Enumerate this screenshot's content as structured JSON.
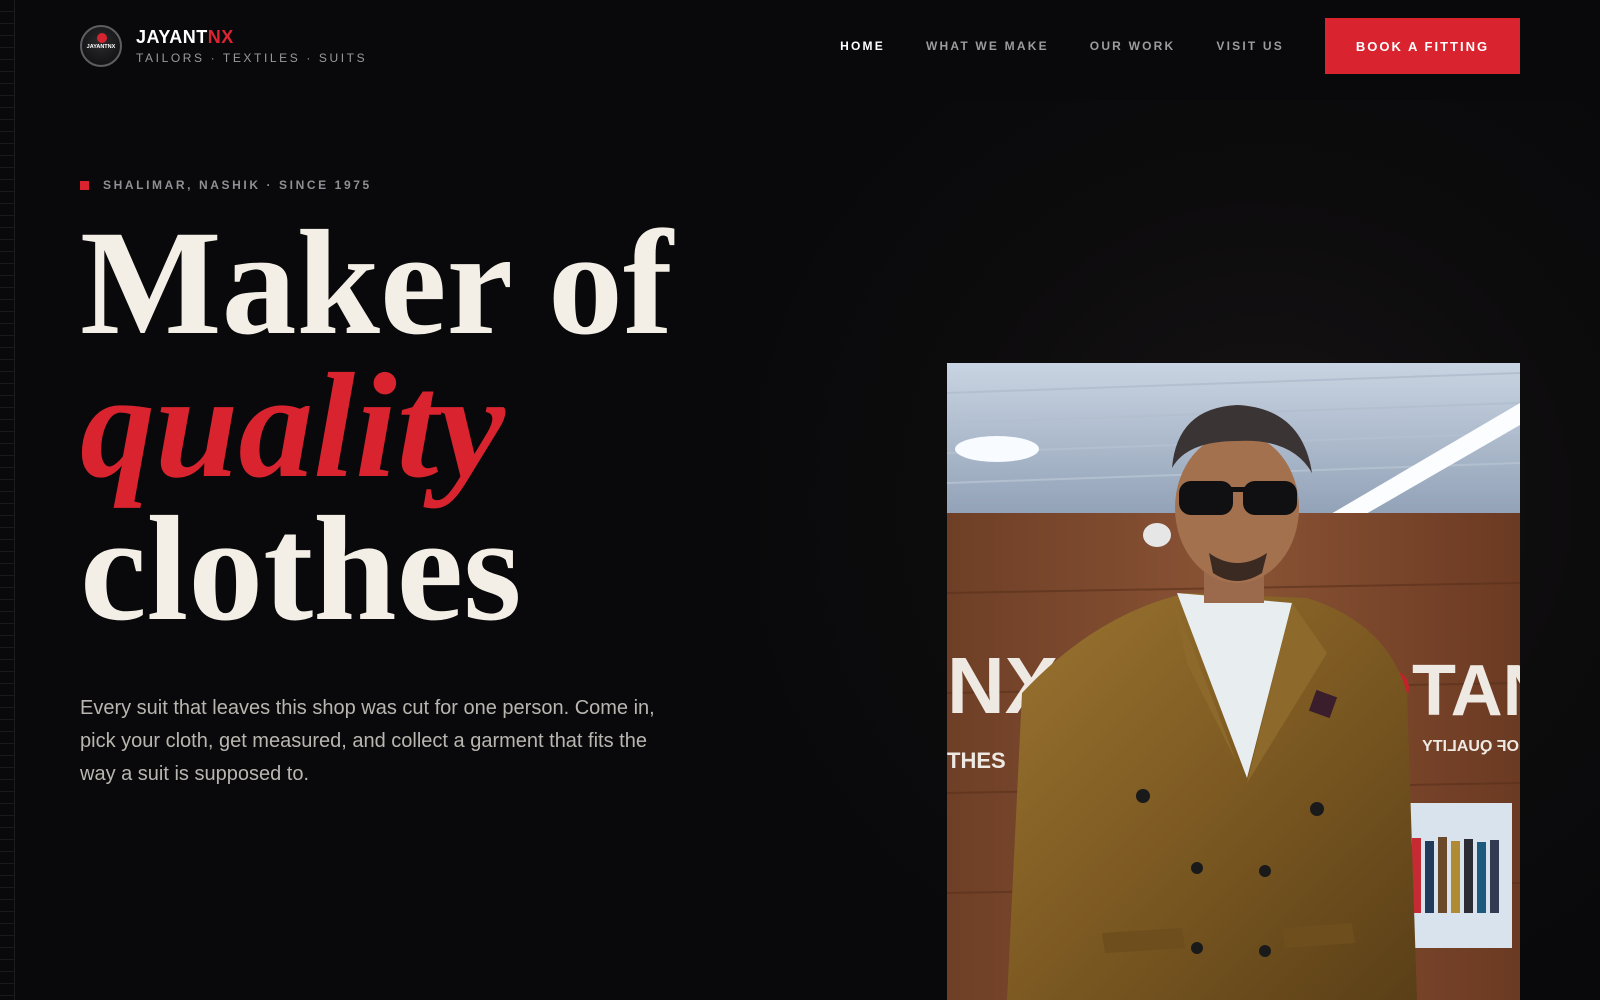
{
  "header": {
    "brand_name": "JAYANT",
    "brand_accent": "NX",
    "brand_tagline": "TAILORS · TEXTILES · SUITS",
    "logo_text": "JAYANTNX",
    "nav": [
      {
        "label": "HOME",
        "active": true
      },
      {
        "label": "WHAT WE MAKE",
        "active": false
      },
      {
        "label": "OUR WORK",
        "active": false
      },
      {
        "label": "VISIT US",
        "active": false
      }
    ],
    "cta_label": "BOOK A FITTING"
  },
  "hero": {
    "eyebrow": "SHALIMAR, NASHIK · SINCE 1975",
    "headline_line1": "Maker of",
    "headline_accent": "quality",
    "headline_line3": "clothes",
    "lead": "Every suit that leaves this shop was cut for one person. Come in, pick your cloth, get measured, and collect a garment that fits the way a suit is supposed to."
  },
  "photo": {
    "sign_left": "NX",
    "sign_right": "TAN",
    "sign_sub": "THES",
    "sign_sub_right": "OF QUALITY"
  },
  "colors": {
    "background": "#09090b",
    "accent": "#d9232f",
    "text": "#f3efe6",
    "muted": "#9b9ba0"
  },
  "icons": [
    "brand-logo-icon",
    "eyebrow-square-icon"
  ]
}
